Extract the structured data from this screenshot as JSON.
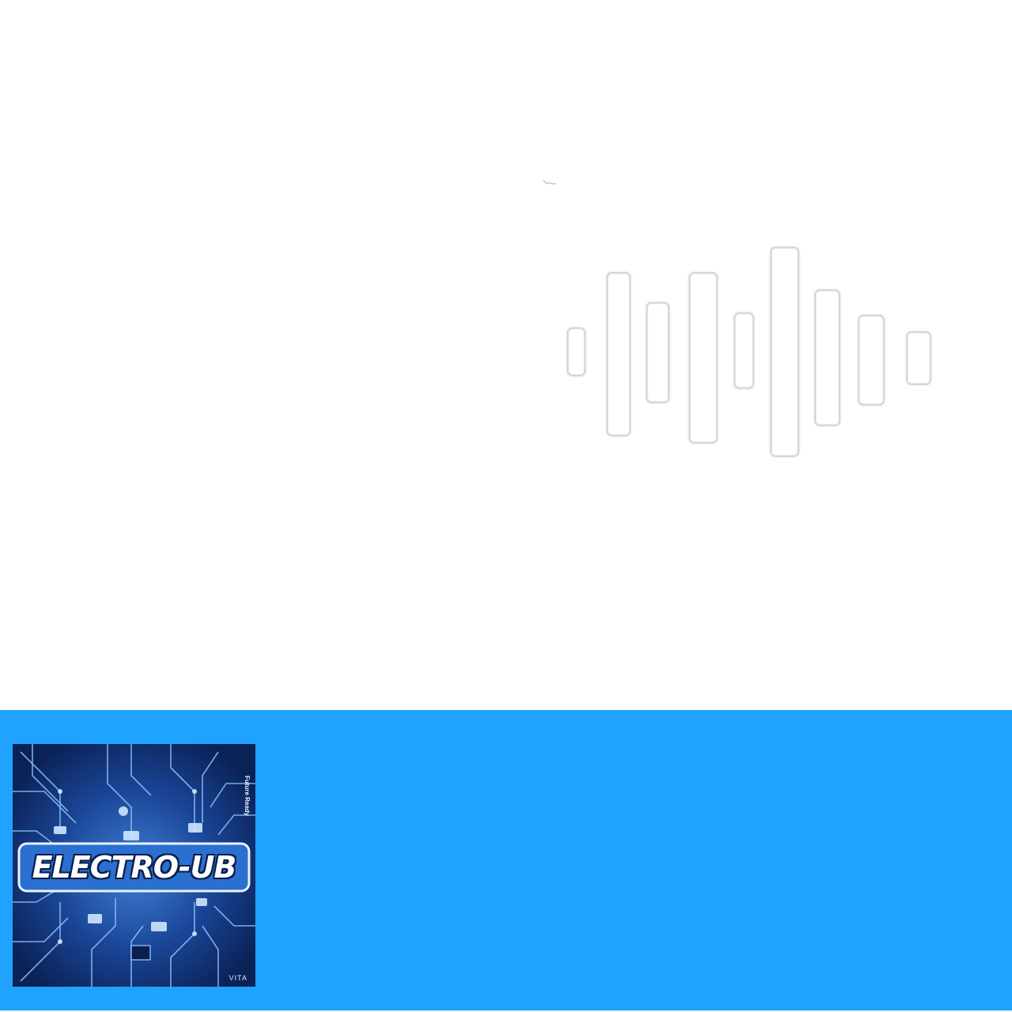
{
  "visualizer": {
    "type": "audio-waveform",
    "bar_style": "outlined-white",
    "bar_count": 9
  },
  "footer": {
    "background_color": "#1fa3ff",
    "cover_art": {
      "title": "ELECTRO-UB",
      "side_text": "Future Ready",
      "badge": "VITA",
      "theme": "circuit-board",
      "colors": {
        "base": "#0e2a66",
        "trace": "#7fb8ff",
        "glow": "#bfe0ff"
      }
    }
  }
}
